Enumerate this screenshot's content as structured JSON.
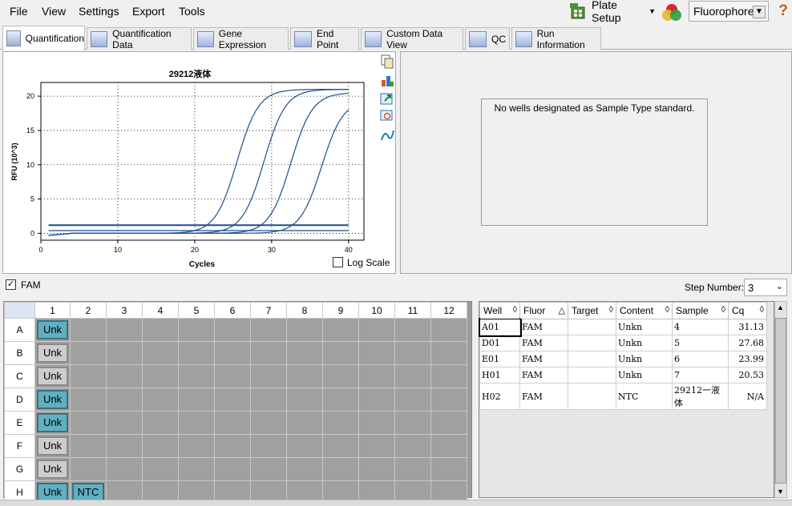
{
  "menu": {
    "file": "File",
    "view": "View",
    "settings": "Settings",
    "export": "Export",
    "tools": "Tools"
  },
  "toolbar": {
    "plate_setup": "Plate Setup",
    "fluorophore": "Fluorophore",
    "help": "?"
  },
  "tabs": [
    {
      "label": "Quantification",
      "active": true
    },
    {
      "label": "Quantification Data"
    },
    {
      "label": "Gene Expression"
    },
    {
      "label": "End Point"
    },
    {
      "label": "Custom Data View"
    },
    {
      "label": "QC"
    },
    {
      "label": "Run Information"
    }
  ],
  "chart_data": {
    "type": "line",
    "title": "29212液体",
    "xlabel": "Cycles",
    "ylabel": "RFU (10^3)",
    "xlim": [
      0,
      42
    ],
    "ylim": [
      -1,
      22
    ],
    "xticks": [
      0,
      10,
      20,
      30,
      40
    ],
    "yticks": [
      0,
      5,
      10,
      15,
      20
    ],
    "grid": true,
    "series": [
      {
        "ct": 23,
        "max": 21.0
      },
      {
        "ct": 26.5,
        "max": 21.0
      },
      {
        "ct": 30,
        "max": 20.5
      },
      {
        "ct": 34,
        "max": 19.5
      },
      {
        "flat": 1.2
      },
      {
        "flat": 0.4
      }
    ],
    "log_scale_label": "Log Scale"
  },
  "std_panel": {
    "message": "No wells designated as Sample Type standard."
  },
  "fluor_bar": {
    "label": "FAM",
    "step_label": "Step Number:",
    "step_value": "3"
  },
  "plate": {
    "columns": [
      "1",
      "2",
      "3",
      "4",
      "5",
      "6",
      "7",
      "8",
      "9",
      "10",
      "11",
      "12"
    ],
    "rows": [
      {
        "row": "A",
        "wells": [
          "Unk"
        ],
        "style": "blue"
      },
      {
        "row": "B",
        "wells": [
          "Unk"
        ],
        "style": "gray"
      },
      {
        "row": "C",
        "wells": [
          "Unk"
        ],
        "style": "gray"
      },
      {
        "row": "D",
        "wells": [
          "Unk"
        ],
        "style": "blue"
      },
      {
        "row": "E",
        "wells": [
          "Unk"
        ],
        "style": "blue"
      },
      {
        "row": "F",
        "wells": [
          "Unk"
        ],
        "style": "gray"
      },
      {
        "row": "G",
        "wells": [
          "Unk"
        ],
        "style": "gray"
      },
      {
        "row": "H",
        "wells": [
          "Unk",
          "NTC"
        ],
        "style": "blue"
      }
    ]
  },
  "results": {
    "headers": [
      "Well",
      "Fluor",
      "Target",
      "Content",
      "Sample",
      "Cq"
    ],
    "rows": [
      [
        "A01",
        "FAM",
        "",
        "Unkn",
        "4",
        "31.13"
      ],
      [
        "D01",
        "FAM",
        "",
        "Unkn",
        "5",
        "27.68"
      ],
      [
        "E01",
        "FAM",
        "",
        "Unkn",
        "6",
        "23.99"
      ],
      [
        "H01",
        "FAM",
        "",
        "Unkn",
        "7",
        "20.53"
      ],
      [
        "H02",
        "FAM",
        "",
        "NTC",
        "29212一液体",
        "N/A"
      ]
    ]
  },
  "colors": {
    "well_blue": "#5fb0c2",
    "curve": "#1f4e8c",
    "help": "#d65c00"
  }
}
